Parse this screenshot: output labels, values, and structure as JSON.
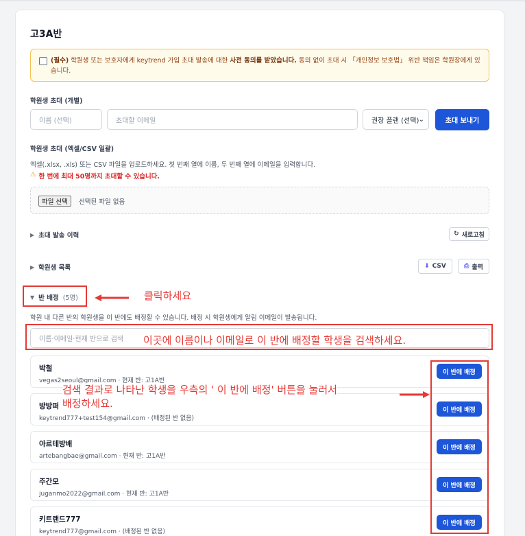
{
  "class_title": "고3A반",
  "notice": {
    "required": "(필수)",
    "text_1": " 학원생 또는 보호자에게 keytrend 가입 초대 발송에 대한 ",
    "consent": "사전 동의를 받았습니다.",
    "text_2": " 동의 없이 초대 시 「개인정보 보호법」 위반 책임은 학원장에게 있습니다."
  },
  "invite_single": {
    "label": "학원생 초대 (개별)",
    "name_placeholder": "이름 (선택)",
    "email_placeholder": "초대할 이메일",
    "plan_select": "권장 플랜 (선택)",
    "send_button": "초대 보내기"
  },
  "invite_bulk": {
    "label": "학원생 초대 (엑셀/CSV 일괄)",
    "description": "엑셀(.xlsx, .xls) 또는 CSV 파일을 업로드하세요. 첫 번째 열에 이름, 두 번째 열에 이메일을 입력합니다.",
    "warning": "한 번에 최대 50명까지 초대할 수 있습니다.",
    "file_button": "파일 선택",
    "file_status": "선택된 파일 없음"
  },
  "invite_history": {
    "label": "초대 발송 이력",
    "refresh_button": "새로고침"
  },
  "student_list": {
    "label": "학원생 목록",
    "csv_button": "CSV",
    "print_button": "출력"
  },
  "class_assign": {
    "label": "반 배정",
    "count": "(5명)",
    "description": "학원 내 다른 반의 학원생을 이 반에도 배정할 수 있습니다. 배정 시 학원생에게 알림 이메일이 발송됩니다.",
    "search_placeholder": "이름·이메일·현재 반으로 검색",
    "assign_button": "이 반에 배정",
    "students": [
      {
        "name": "박철",
        "detail": "vegas2seoul@gmail.com · 현재 반: 고1A반"
      },
      {
        "name": "방방떠",
        "detail": "keytrend777+test154@gmail.com · (배정된 반 없음)"
      },
      {
        "name": "아르테방배",
        "detail": "artebangbae@gmail.com · 현재 반: 고1A반"
      },
      {
        "name": "주간모",
        "detail": "juganmo2022@gmail.com · 현재 반: 고1A반"
      },
      {
        "name": "키트랜드777",
        "detail": "keytrend777@gmail.com · (배정된 반 없음)"
      }
    ]
  },
  "annotations": {
    "click_here": "클릭하세요",
    "search_hint": "이곳에 이름이나 이메일로 이 반에 배정할 학생을 검색하세요.",
    "assign_hint_1": "검색 결과로 나타난 학생을 우측의 ' 이 반에 배정' 버튼을 눌러서",
    "assign_hint_2": "배정하세요."
  },
  "colors": {
    "primary": "#1d56d8",
    "warning_border": "#f5c158",
    "annotation_red": "#e53935"
  }
}
